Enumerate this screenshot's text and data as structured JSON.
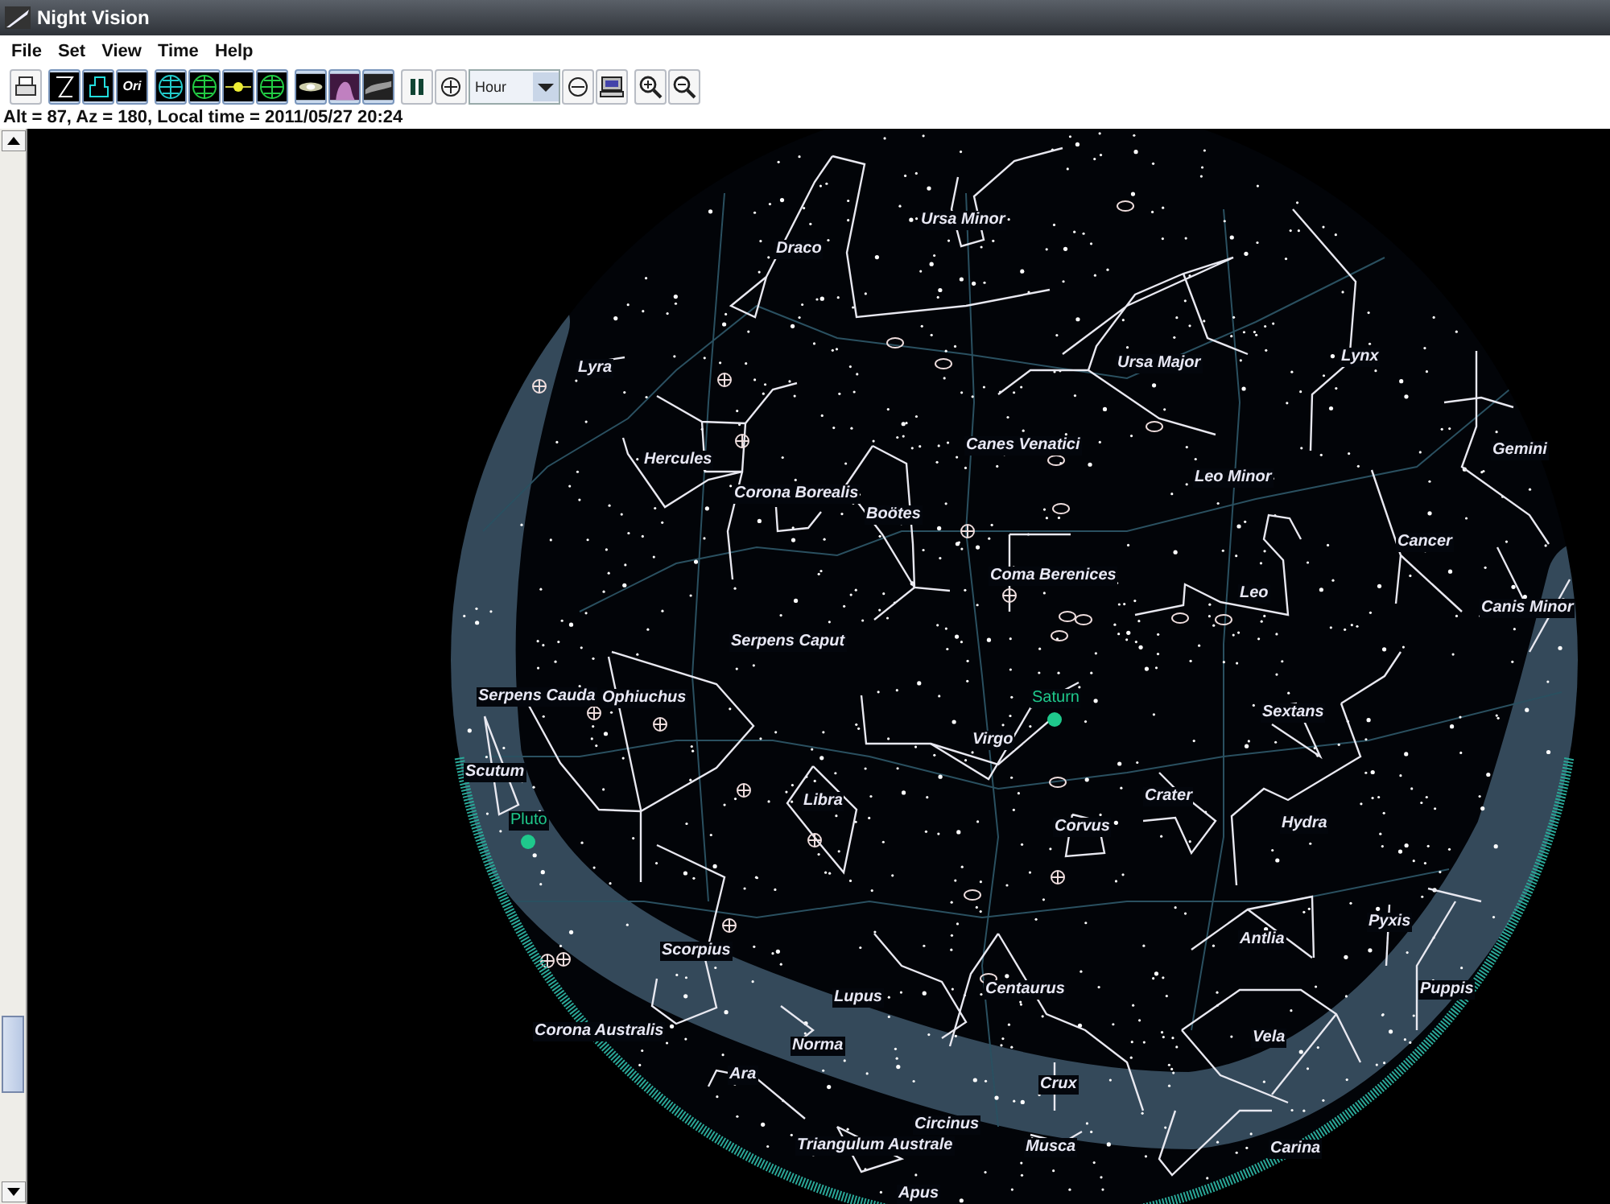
{
  "window": {
    "title": "Night Vision"
  },
  "menu": [
    "File",
    "Set",
    "View",
    "Time",
    "Help"
  ],
  "toolbar": [
    [
      {
        "kind": "print"
      }
    ],
    [
      {
        "kind": "figures",
        "selected": true
      },
      {
        "kind": "boundaries",
        "selected": true
      },
      {
        "kind": "names",
        "label": "Ori",
        "selected": true
      }
    ],
    [
      {
        "kind": "equatorial-grid",
        "selected": true
      },
      {
        "kind": "horizontal-grid",
        "selected": true
      },
      {
        "kind": "ecliptic",
        "selected": true
      },
      {
        "kind": "horizon",
        "selected": true
      }
    ],
    [
      {
        "kind": "planets",
        "selected": true
      },
      {
        "kind": "nebula",
        "selected": true
      },
      {
        "kind": "milkyway",
        "selected": true
      }
    ],
    [
      {
        "kind": "pause"
      },
      {
        "kind": "step-forward"
      },
      {
        "kind": "dropdown",
        "value": "Hour"
      },
      {
        "kind": "step-back"
      },
      {
        "kind": "computer"
      }
    ],
    [
      {
        "kind": "zoom-in"
      },
      {
        "kind": "zoom-out"
      }
    ]
  ],
  "status": "Alt = 87, Az = 180, Local time = 2011/05/27 20:24",
  "sky": {
    "constellations": [
      "Ursa Minor",
      "Draco",
      "Lyra",
      "Ursa Major",
      "Lynx",
      "Gemini",
      "Hercules",
      "Corona Borealis",
      "Boötes",
      "Canes Venatici",
      "Leo Minor",
      "Cancer",
      "Coma Berenices",
      "Leo",
      "Canis Minor",
      "Serpens Caput",
      "Serpens Cauda",
      "Ophiuchus",
      "Sextans",
      "Virgo",
      "Scutum",
      "Libra",
      "Crater",
      "Corvus",
      "Hydra",
      "Scorpius",
      "Antlia",
      "Pyxis",
      "Lupus",
      "Centaurus",
      "Puppis",
      "Corona Australis",
      "Norma",
      "Vela",
      "Ara",
      "Crux",
      "Circinus",
      "Triangulum Australe",
      "Musca",
      "Carina",
      "Apus"
    ],
    "planets": [
      {
        "name": "Saturn",
        "color": "#1fc98c"
      },
      {
        "name": "Pluto",
        "color": "#1fc98c"
      }
    ]
  }
}
